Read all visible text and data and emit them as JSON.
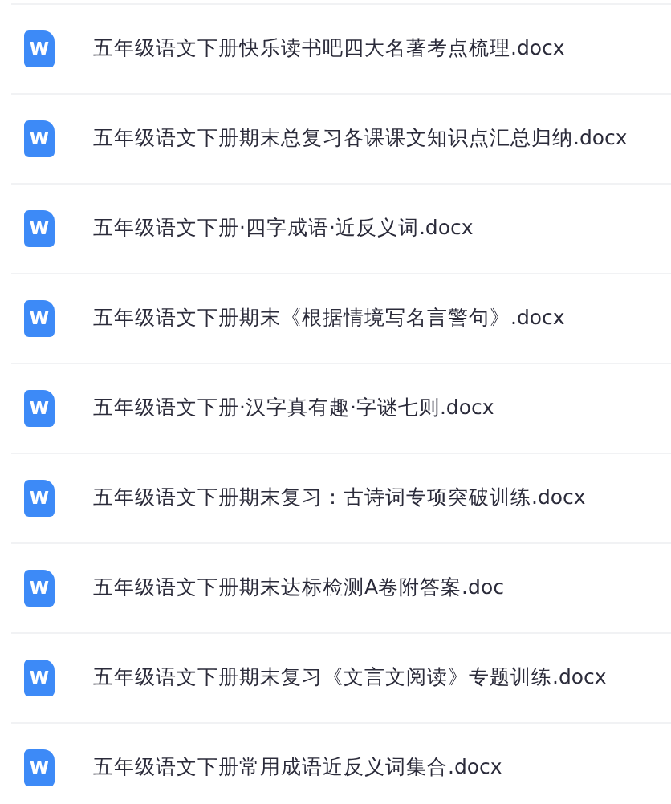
{
  "files": [
    {
      "icon_label": "W",
      "name": "五年级语文下册快乐读书吧四大名著考点梳理.docx"
    },
    {
      "icon_label": "W",
      "name": "五年级语文下册期末总复习各课课文知识点汇总归纳.docx"
    },
    {
      "icon_label": "W",
      "name": "五年级语文下册·四字成语·近反义词.docx"
    },
    {
      "icon_label": "W",
      "name": "五年级语文下册期末《根据情境写名言警句》.docx"
    },
    {
      "icon_label": "W",
      "name": "五年级语文下册·汉字真有趣·字谜七则.docx"
    },
    {
      "icon_label": "W",
      "name": "五年级语文下册期末复习：古诗词专项突破训练.docx"
    },
    {
      "icon_label": "W",
      "name": "五年级语文下册期末达标检测A卷附答案.doc"
    },
    {
      "icon_label": "W",
      "name": "五年级语文下册期末复习《文言文阅读》专题训练.docx"
    },
    {
      "icon_label": "W",
      "name": "五年级语文下册常用成语近反义词集合.docx"
    }
  ]
}
